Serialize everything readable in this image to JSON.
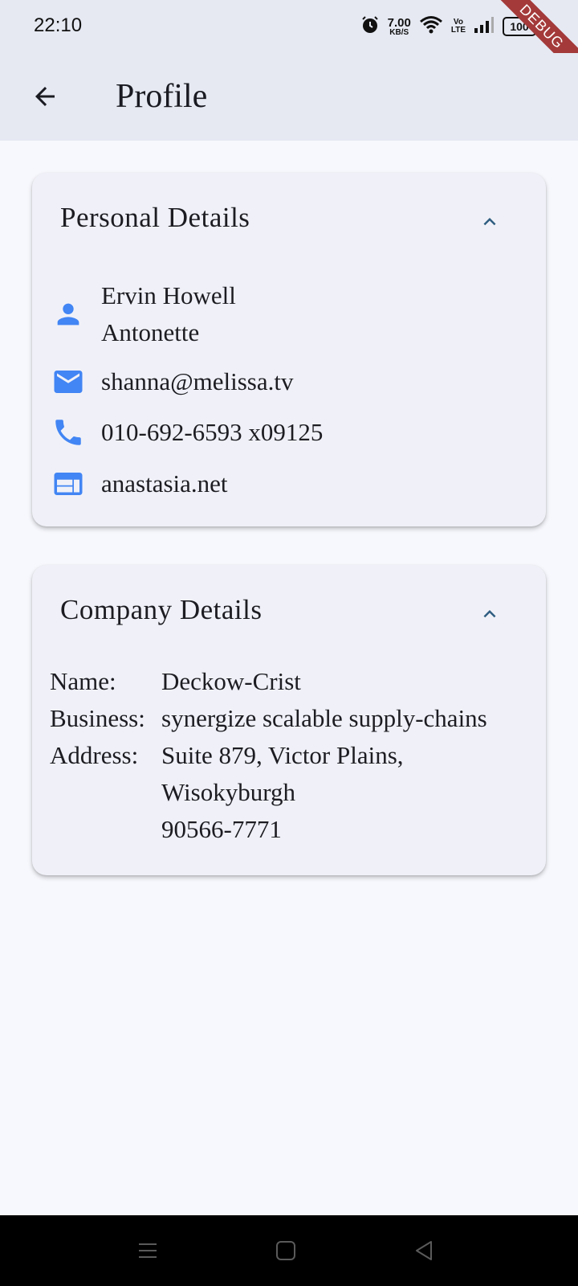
{
  "status_bar": {
    "time": "22:10",
    "net_speed_value": "7.00",
    "net_speed_unit": "KB/S",
    "volte_top": "Vo",
    "volte_bottom": "LTE",
    "battery": "100",
    "icons": [
      "alarm-icon",
      "wifi-icon",
      "signal-icon",
      "battery-icon"
    ]
  },
  "debug_banner": "DEBUG",
  "app_bar": {
    "title": "Profile",
    "back_icon": "arrow-back-icon"
  },
  "personal": {
    "title": "Personal Details",
    "name": "Ervin Howell",
    "username": "Antonette",
    "email": "shanna@melissa.tv",
    "phone": "010-692-6593 x09125",
    "website": "anastasia.net",
    "accent_color": "#4285f4"
  },
  "company": {
    "title": "Company Details",
    "name_label": "Name:",
    "name_value": "Deckow-Crist",
    "business_label": "Business:",
    "business_value": "synergize scalable supply-chains",
    "address_label": "Address:",
    "address_line1": "Suite 879, Victor Plains,",
    "address_line2": "Wisokyburgh",
    "address_line3": "90566-7771"
  },
  "nav_bar": {
    "icons": [
      "menu-icon",
      "home-square-icon",
      "back-triangle-icon"
    ]
  }
}
